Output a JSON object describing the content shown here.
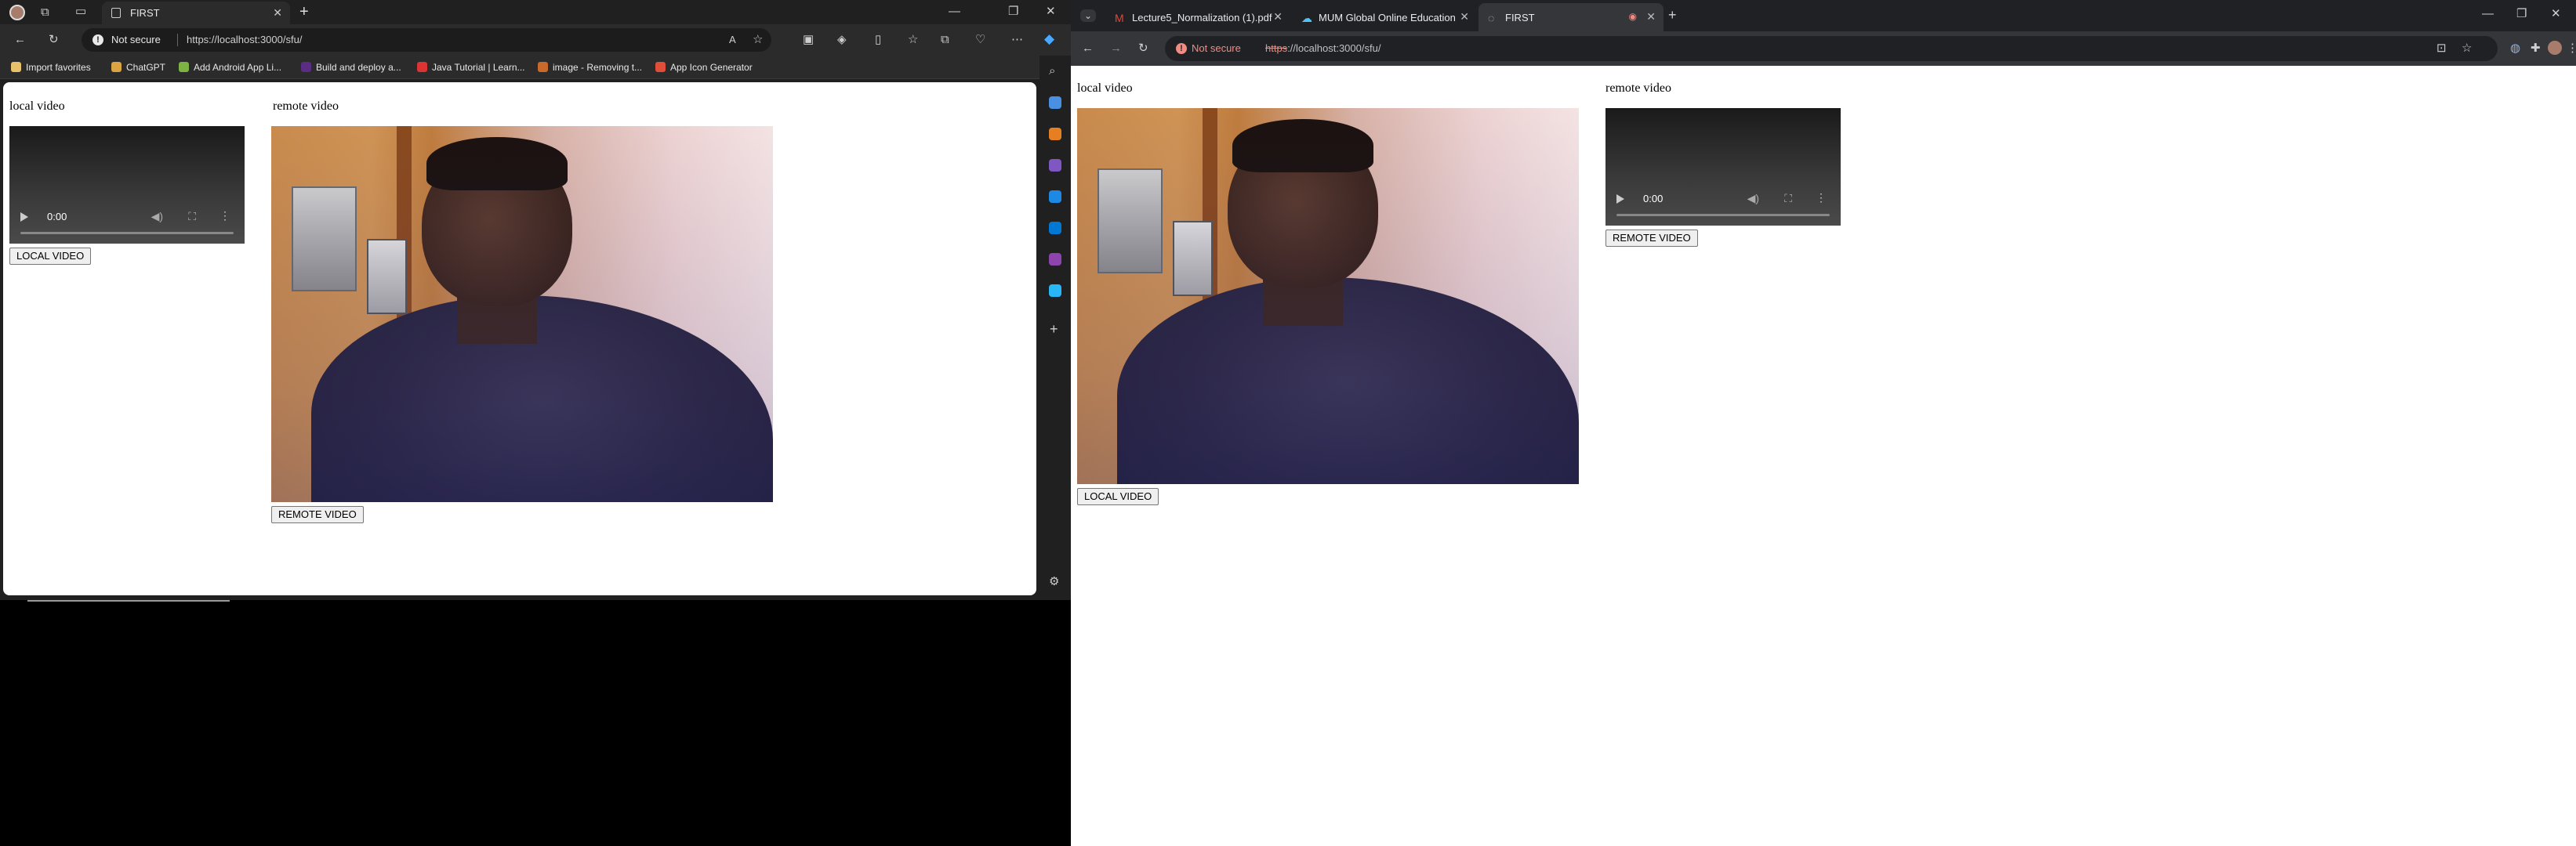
{
  "left_window": {
    "tab": {
      "title": "FIRST"
    },
    "address_bar": {
      "security": "Not secure",
      "url": "https://localhost:3000/sfu/"
    },
    "bookmarks": [
      {
        "label": "Import favorites",
        "icon": "folder-icon",
        "color": "#e8c26a"
      },
      {
        "label": "ChatGPT",
        "icon": "chatgpt-icon",
        "color": "#d9a441"
      },
      {
        "label": "Add Android App Li...",
        "icon": "android-icon",
        "color": "#7cb342"
      },
      {
        "label": "Build and deploy a...",
        "icon": "deploy-icon",
        "color": "#5b2c83"
      },
      {
        "label": "Java Tutorial | Learn...",
        "icon": "heart-icon",
        "color": "#d33"
      },
      {
        "label": "image - Removing t...",
        "icon": "stack-icon",
        "color": "#c96a2a"
      },
      {
        "label": "App Icon Generator",
        "icon": "grid-icon",
        "color": "#e04e39"
      }
    ],
    "page": {
      "local_label": "local video",
      "remote_label": "remote video",
      "local_time": "0:00",
      "local_button": "LOCAL VIDEO",
      "remote_button": "REMOTE VIDEO"
    }
  },
  "right_window": {
    "tabs": [
      {
        "title": "Lecture5_Normalization (1).pdf",
        "icon": "gmail-icon",
        "color": "#ea4335",
        "active": false
      },
      {
        "title": "MUM Global Online Education",
        "icon": "cloud-icon",
        "color": "#4fc3f7",
        "active": false
      },
      {
        "title": "FIRST",
        "icon": "globe-icon",
        "color": "#bdc1c6",
        "active": true
      }
    ],
    "address_bar": {
      "security": "Not secure",
      "url_scheme": "https",
      "url_rest": "://localhost:3000/sfu/"
    },
    "page": {
      "local_label": "local video",
      "remote_label": "remote video",
      "remote_time": "0:00",
      "local_button": "LOCAL VIDEO",
      "remote_button": "REMOTE VIDEO"
    }
  }
}
